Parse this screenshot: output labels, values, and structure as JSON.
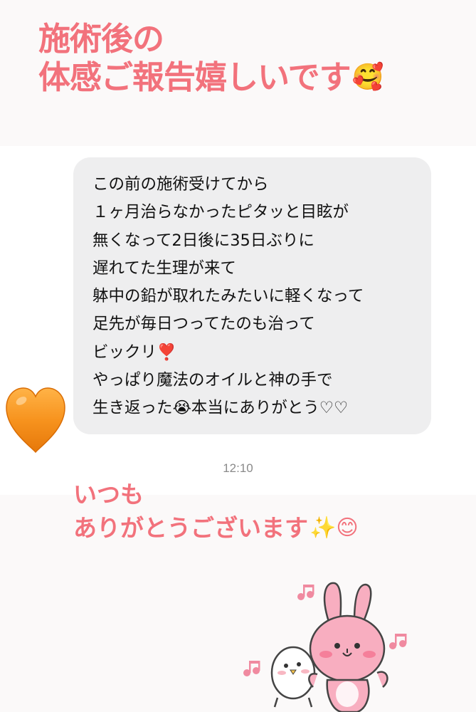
{
  "header": {
    "line1": "施術後の",
    "line2": "体感ご報告嬉しいです",
    "emoji": "🥰"
  },
  "message": {
    "lines": [
      "この前の施術受けてから",
      "１ヶ月治らなかったピタッと目眩が",
      "無くなって2日後に35日ぶりに",
      "遅れてた生理が来て",
      "躰中の鉛が取れたみたいに軽くなって",
      "足先が毎日つってたのも治って",
      "ビックリ❣️",
      "やっぱり魔法のオイルと神の手で",
      "生き返った😭本当にありがとう♡♡"
    ],
    "timestamp": "12:10"
  },
  "reply": {
    "line1": "いつも",
    "line2": "ありがとうございます",
    "emoji": "✨😊"
  },
  "colors": {
    "accent": "#f2727c",
    "bubble": "#eeeeef",
    "heart": "#f7931e"
  },
  "icons": {
    "heart": "orange-heart-icon",
    "sticker": "rabbit-and-bird-sticker"
  }
}
